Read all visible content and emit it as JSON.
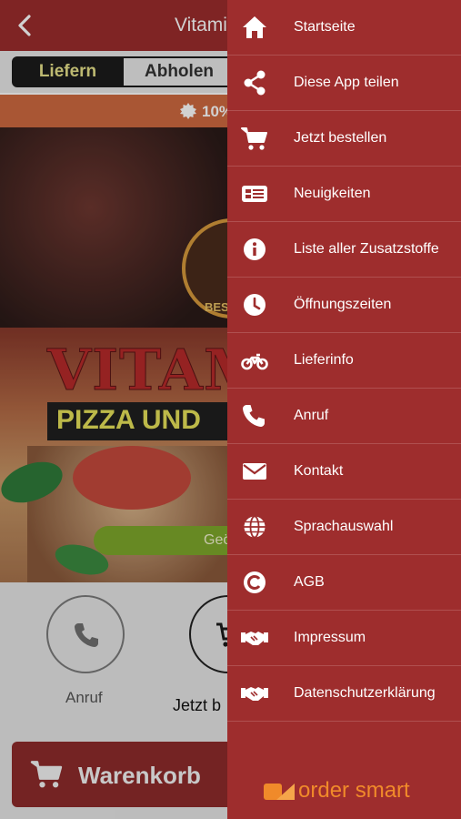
{
  "header": {
    "title": "Vitamin"
  },
  "delivery_toggle": {
    "deliver_label": "Liefern",
    "pickup_label": "Abholen"
  },
  "promo": {
    "text": "10%"
  },
  "hero": {
    "badge_text": "BEST",
    "brand_text": "VITAMIN",
    "slogan_text": "PIZZA UND",
    "status_text": "Geö"
  },
  "actions": {
    "call_label": "Anruf",
    "order_label": "Jetzt b"
  },
  "cart": {
    "label": "Warenkorb"
  },
  "drawer": {
    "items": [
      {
        "label": "Startseite",
        "icon": "home-icon"
      },
      {
        "label": "Diese App teilen",
        "icon": "share-icon"
      },
      {
        "label": "Jetzt bestellen",
        "icon": "cart-icon"
      },
      {
        "label": "Neuigkeiten",
        "icon": "news-icon"
      },
      {
        "label": "Liste aller Zusatzstoffe",
        "icon": "info-icon"
      },
      {
        "label": "Öffnungszeiten",
        "icon": "clock-icon"
      },
      {
        "label": "Lieferinfo",
        "icon": "motorcycle-icon"
      },
      {
        "label": "Anruf",
        "icon": "phone-icon"
      },
      {
        "label": "Kontakt",
        "icon": "mail-icon"
      },
      {
        "label": "Sprachauswahl",
        "icon": "globe-icon"
      },
      {
        "label": "AGB",
        "icon": "copyright-icon"
      },
      {
        "label": "Impressum",
        "icon": "handshake-icon"
      },
      {
        "label": "Datenschutzerklärung",
        "icon": "handshake-icon"
      }
    ],
    "footer_logo_text": "order smart"
  },
  "colors": {
    "brand": "#9e2d2d",
    "promo": "#cf6a40",
    "accent_yellow": "#e7e28a",
    "status_green": "#7ea82b",
    "logo_orange": "#f08a2a"
  }
}
